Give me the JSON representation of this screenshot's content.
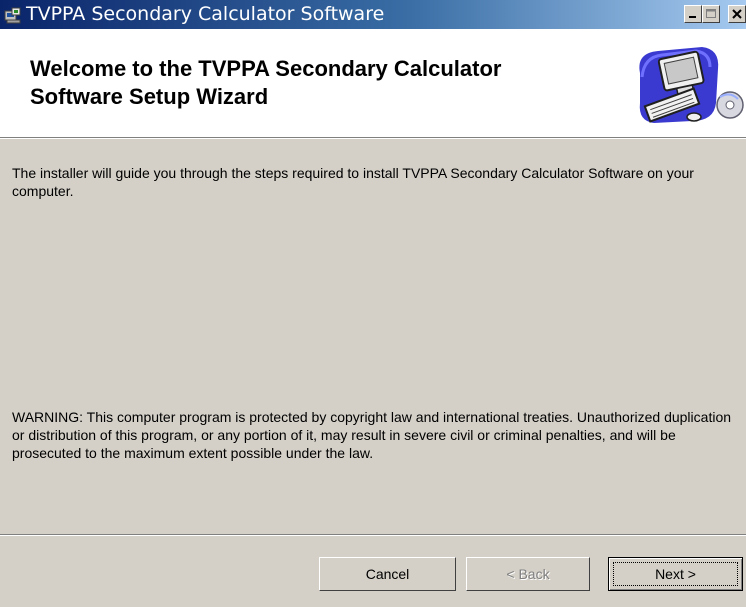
{
  "window": {
    "title": "TVPPA Secondary Calculator Software",
    "controls": [
      "minimize",
      "maximize",
      "close"
    ]
  },
  "header": {
    "title": "Welcome to the TVPPA Secondary Calculator Software Setup Wizard",
    "icon": "computer-setup-illustration"
  },
  "main": {
    "intro": "The installer will guide you through the steps required to install TVPPA Secondary Calculator Software on your computer.",
    "warning": "WARNING: This computer program is protected by copyright law and international treaties. Unauthorized duplication or distribution of this program, or any portion of it, may result in severe civil or criminal penalties, and will be prosecuted to the maximum extent possible under the law."
  },
  "buttons": {
    "cancel": "Cancel",
    "back": "< Back",
    "next": "Next >"
  },
  "colors": {
    "titlebar_start": "#0a246a",
    "titlebar_end": "#a6caf0",
    "dialog_bg": "#d4d0c8",
    "header_bg": "#ffffff"
  }
}
